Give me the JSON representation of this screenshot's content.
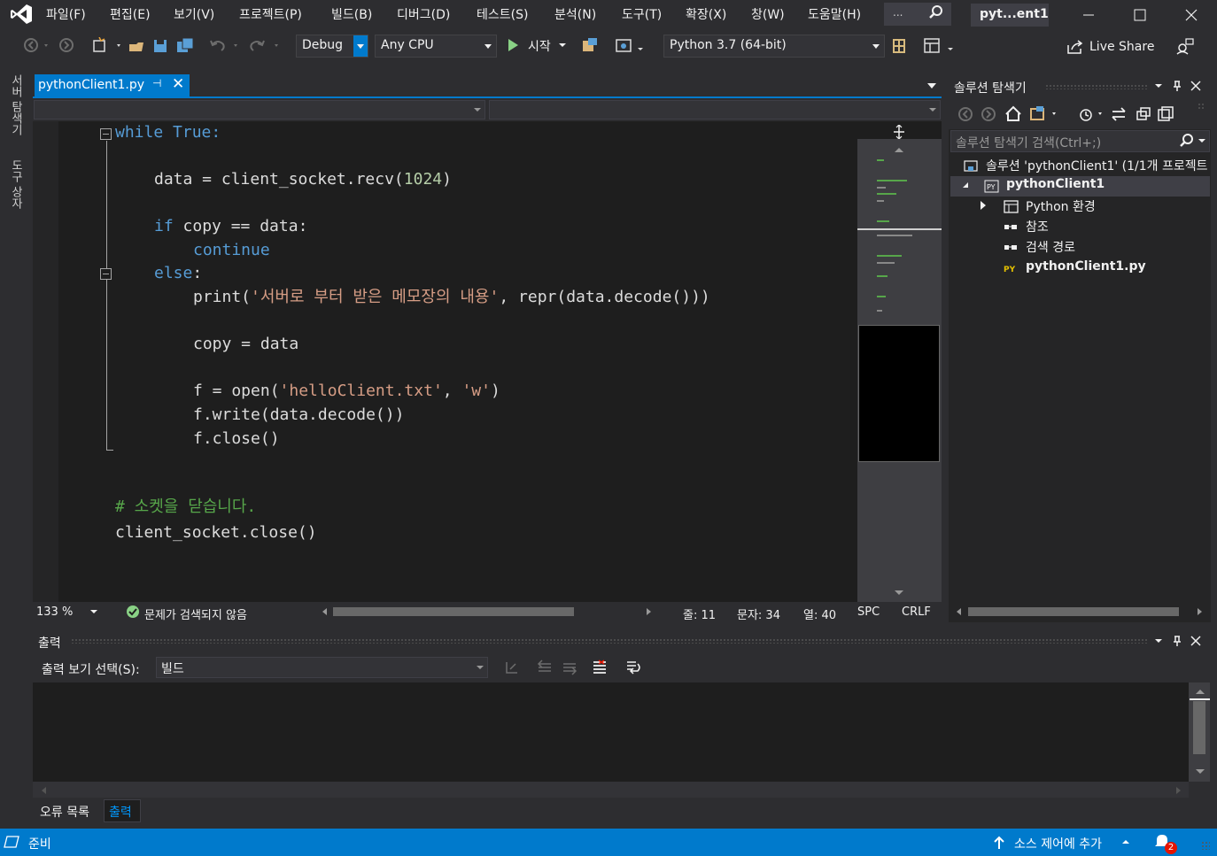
{
  "colors": {
    "accent": "#007acc",
    "keyword": "#569cd6",
    "string": "#d69d85",
    "number": "#b5cea8",
    "comment": "#57a64a",
    "ok_green": "#89d185"
  },
  "menubar": {
    "items": [
      "파일(F)",
      "편집(E)",
      "보기(V)",
      "프로젝트(P)",
      "빌드(B)",
      "디버그(D)",
      "테스트(S)",
      "분석(N)",
      "도구(T)",
      "확장(X)",
      "창(W)",
      "도움말(H)"
    ],
    "search_ellipsis": "...",
    "window_title": "pyt...ent1"
  },
  "toolbar": {
    "config": "Debug",
    "platform": "Any CPU",
    "start_label": "시작",
    "python_env": "Python 3.7 (64-bit)",
    "live_share": "Live Share"
  },
  "side_tabs": [
    "서버 탐색기",
    "도구 상자"
  ],
  "editor": {
    "tab_label": "pythonClient1.py",
    "tab_pin": "⊣",
    "tab_close": "✕",
    "lines": [
      {
        "segments": [
          {
            "t": "while",
            "c": "kw"
          },
          {
            "t": " True:",
            "c": "kw"
          }
        ]
      },
      {
        "segments": [
          {
            "t": "data = client_socket.recv(",
            "c": ""
          },
          {
            "t": "1024",
            "c": "num"
          },
          {
            "t": ")",
            "c": ""
          }
        ]
      },
      {
        "segments": [
          {
            "t": "if",
            "c": "kw"
          },
          {
            "t": " copy == data:",
            "c": ""
          }
        ]
      },
      {
        "segments": [
          {
            "t": "continue",
            "c": "kw"
          }
        ]
      },
      {
        "segments": [
          {
            "t": "else",
            "c": "kw"
          },
          {
            "t": ":",
            "c": ""
          }
        ]
      },
      {
        "segments": [
          {
            "t": "print(",
            "c": ""
          },
          {
            "t": "'서버로 부터 받은 메모장의 내용'",
            "c": "str"
          },
          {
            "t": ", repr(data.decode()))",
            "c": ""
          }
        ]
      },
      {
        "segments": [
          {
            "t": "copy = data",
            "c": ""
          }
        ]
      },
      {
        "segments": [
          {
            "t": "f = open(",
            "c": ""
          },
          {
            "t": "'helloClient.txt'",
            "c": "str"
          },
          {
            "t": ", ",
            "c": ""
          },
          {
            "t": "'w'",
            "c": "str"
          },
          {
            "t": ")",
            "c": ""
          }
        ]
      },
      {
        "segments": [
          {
            "t": "f.write(data.decode())",
            "c": ""
          }
        ]
      },
      {
        "segments": [
          {
            "t": "f.close()",
            "c": ""
          }
        ]
      },
      {
        "segments": [
          {
            "t": "# 소켓을 닫습니다.",
            "c": "cmt"
          }
        ]
      },
      {
        "segments": [
          {
            "t": "client_socket.close()",
            "c": ""
          }
        ]
      }
    ],
    "zoom": "133 %",
    "issues": "문제가 검색되지 않음",
    "line": "줄: 11",
    "char": "문자: 34",
    "col": "열: 40",
    "whitespace": "SPC",
    "line_ending": "CRLF"
  },
  "solution_explorer": {
    "title": "솔루션 탐색기",
    "search_placeholder": "솔루션 탐색기 검색(Ctrl+;)",
    "tree": [
      {
        "label": "솔루션 'pythonClient1' (1/1개 프로젝트",
        "level": 0,
        "icon": "solution-icon"
      },
      {
        "label": "pythonClient1",
        "level": 1,
        "icon": "python-project-icon",
        "bold": true,
        "selected": true,
        "expanded": true
      },
      {
        "label": "Python 환경",
        "level": 2,
        "icon": "python-env-icon",
        "collapsed": true
      },
      {
        "label": "참조",
        "level": 2,
        "icon": "references-icon"
      },
      {
        "label": "검색 경로",
        "level": 2,
        "icon": "search-path-icon"
      },
      {
        "label": "pythonClient1.py",
        "level": 2,
        "icon": "python-file-icon",
        "bold": true
      }
    ]
  },
  "output": {
    "title": "출력",
    "source_label": "출력 보기 선택(S):",
    "source_value": "빌드"
  },
  "bottom_tabs": [
    "오류 목록",
    "출력"
  ],
  "statusbar": {
    "ready": "준비",
    "source_control": "소스 제어에 추가",
    "notification_count": "2"
  }
}
